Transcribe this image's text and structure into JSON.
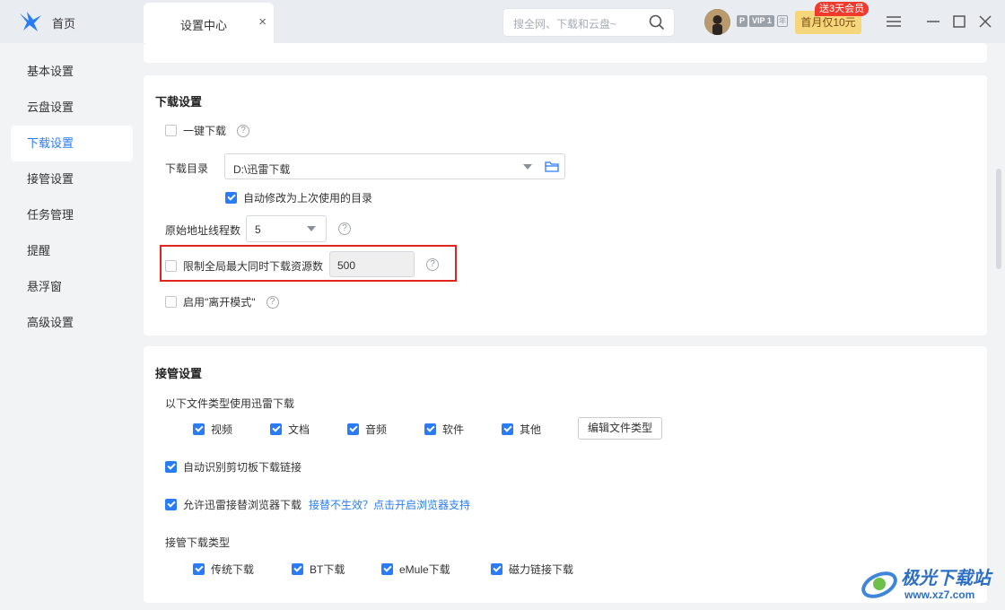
{
  "titlebar": {
    "home_label": "首页",
    "tab_label": "设置中心",
    "tab_close": "×",
    "search_placeholder": "搜全网、下载和云盘~",
    "badge_p": "P",
    "badge_vip": "VIP 1",
    "badge_year": "年",
    "promo_label": "首月仅10元",
    "promo_tag": "送3天会员"
  },
  "sidebar": {
    "items": [
      {
        "label": "基本设置"
      },
      {
        "label": "云盘设置"
      },
      {
        "label": "下载设置"
      },
      {
        "label": "接管设置"
      },
      {
        "label": "任务管理"
      },
      {
        "label": "提醒"
      },
      {
        "label": "悬浮窗"
      },
      {
        "label": "高级设置"
      }
    ],
    "active_index": 2
  },
  "download": {
    "title": "下载设置",
    "one_click_label": "一键下载",
    "dir_label": "下载目录",
    "dir_value": "D:\\迅雷下载",
    "auto_dir_label": "自动修改为上次使用的目录",
    "threads_label": "原始地址线程数",
    "threads_value": "5",
    "limit_label": "限制全局最大同时下载资源数",
    "limit_value": "500",
    "away_label": "启用\"离开模式\"",
    "help_glyph": "?"
  },
  "takeover": {
    "title": "接管设置",
    "file_types_label": "以下文件类型使用迅雷下载",
    "file_types": [
      {
        "label": "视频"
      },
      {
        "label": "文档"
      },
      {
        "label": "音频"
      },
      {
        "label": "软件"
      },
      {
        "label": "其他"
      }
    ],
    "edit_button": "编辑文件类型",
    "clipboard_label": "自动识别剪切板下载链接",
    "browser_label": "允许迅雷接替浏览器下载",
    "browser_link": "接替不生效？点击开启浏览器支持",
    "types_label": "接管下载类型",
    "download_types": [
      {
        "label": "传统下载"
      },
      {
        "label": "BT下载"
      },
      {
        "label": "eMule下载"
      },
      {
        "label": "磁力链接下载"
      }
    ]
  },
  "watermark": {
    "name": "极光下载站",
    "url": "www.xz7.com"
  },
  "colors": {
    "accent": "#2a7cf6",
    "highlight_border": "#e3241e",
    "promo_bg": "#f5d67a",
    "promo_tag_bg": "#f03a2e"
  }
}
